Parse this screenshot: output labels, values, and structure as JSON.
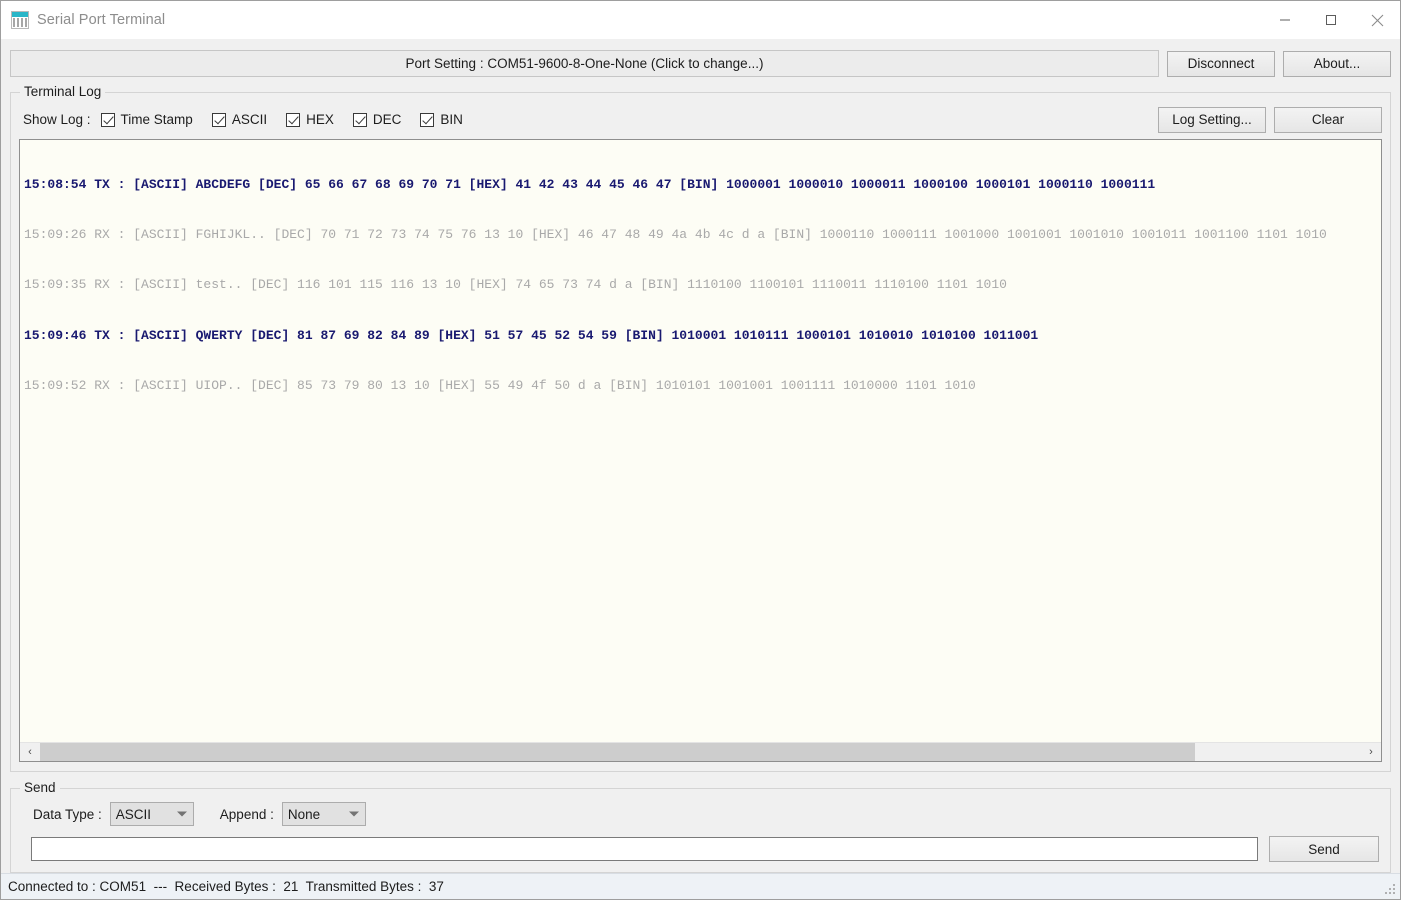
{
  "window": {
    "title": "Serial Port Terminal",
    "icon": "serial-terminal-icon",
    "minimize": "—",
    "maximize": "□",
    "close": "✕"
  },
  "toolbar": {
    "port_setting_label": "Port Setting : COM51-9600-8-One-None (Click to change...)",
    "disconnect_label": "Disconnect",
    "about_label": "About..."
  },
  "terminal_log": {
    "group_title": "Terminal Log",
    "show_log_label": "Show Log :",
    "checkboxes": [
      {
        "label": "Time Stamp",
        "checked": true
      },
      {
        "label": "ASCII",
        "checked": true
      },
      {
        "label": "HEX",
        "checked": true
      },
      {
        "label": "DEC",
        "checked": true
      },
      {
        "label": "BIN",
        "checked": true
      }
    ],
    "log_setting_label": "Log Setting...",
    "clear_label": "Clear",
    "lines": [
      {
        "dir": "tx",
        "text": "15:08:54 TX : [ASCII] ABCDEFG [DEC] 65 66 67 68 69 70 71 [HEX] 41 42 43 44 45 46 47 [BIN] 1000001 1000010 1000011 1000100 1000101 1000110 1000111"
      },
      {
        "dir": "rx",
        "text": "15:09:26 RX : [ASCII] FGHIJKL.. [DEC] 70 71 72 73 74 75 76 13 10 [HEX] 46 47 48 49 4a 4b 4c d a [BIN] 1000110 1000111 1001000 1001001 1001010 1001011 1001100 1101 1010"
      },
      {
        "dir": "rx",
        "text": "15:09:35 RX : [ASCII] test.. [DEC] 116 101 115 116 13 10 [HEX] 74 65 73 74 d a [BIN] 1110100 1100101 1110011 1110100 1101 1010"
      },
      {
        "dir": "tx",
        "text": "15:09:46 TX : [ASCII] QWERTY [DEC] 81 87 69 82 84 89 [HEX] 51 57 45 52 54 59 [BIN] 1010001 1010111 1000101 1010010 1010100 1011001"
      },
      {
        "dir": "rx",
        "text": "15:09:52 RX : [ASCII] UIOP.. [DEC] 85 73 79 80 13 10 [HEX] 55 49 4f 50 d a [BIN] 1010101 1001001 1001111 1010000 1101 1010"
      }
    ],
    "scroll_left_icon": "‹",
    "scroll_right_icon": "›"
  },
  "send": {
    "group_title": "Send",
    "data_type_label": "Data Type :",
    "data_type_value": "ASCII",
    "append_label": "Append :",
    "append_value": "None",
    "input_value": "",
    "input_placeholder": "",
    "send_label": "Send"
  },
  "status": {
    "text": "Connected to : COM51  ---  Received Bytes :  21  Transmitted Bytes :  37"
  },
  "colors": {
    "tx": "#191970",
    "rx": "#a9a9a9",
    "accent": "#29b6c8",
    "log_bg": "#fdfdf5"
  }
}
